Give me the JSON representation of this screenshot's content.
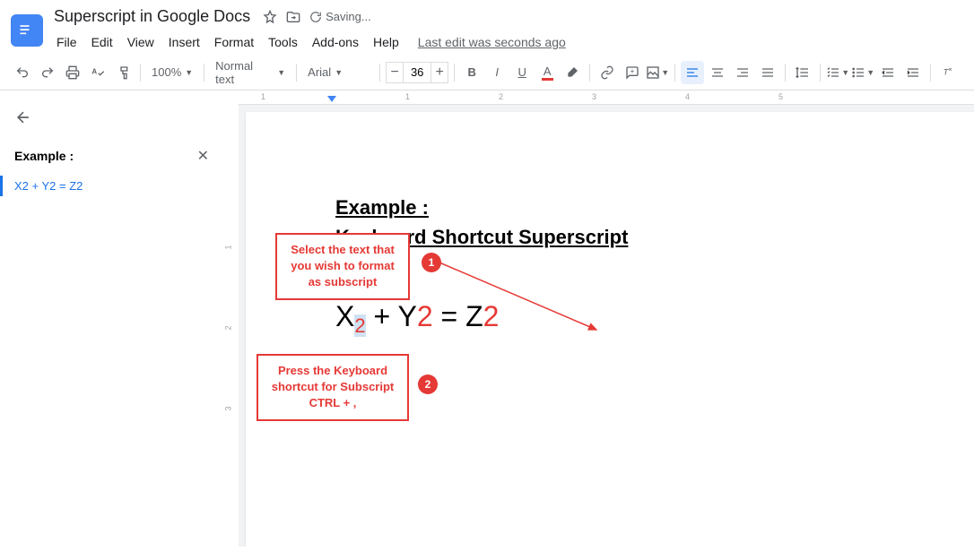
{
  "header": {
    "doc_title": "Superscript in Google Docs",
    "saving_label": "Saving...",
    "last_edit": "Last edit was seconds ago"
  },
  "menubar": [
    "File",
    "Edit",
    "View",
    "Insert",
    "Format",
    "Tools",
    "Add-ons",
    "Help"
  ],
  "toolbar": {
    "zoom": "100%",
    "style": "Normal text",
    "font": "Arial",
    "font_size": "36"
  },
  "outline": {
    "header": "Example :",
    "items": [
      "X2 + Y2 = Z2"
    ]
  },
  "hruler": {
    "ticks": [
      "1",
      "",
      "1",
      "2",
      "3",
      "4",
      "5"
    ]
  },
  "vruler": {
    "ticks": [
      "1",
      "2",
      "3"
    ]
  },
  "document": {
    "line1": "Example :",
    "line2": "Keyboard Shortcut Superscript",
    "eq": {
      "p1": "X",
      "sub": "2",
      "p2": " + Y",
      "p2_red": "2",
      "p3": " = Z",
      "p3_red": "2"
    }
  },
  "callouts": {
    "c1": {
      "line1": "Select the text that",
      "line2": "you wish to format",
      "line3": "as subscript",
      "badge": "1"
    },
    "c2": {
      "line1": "Press the Keyboard",
      "line2": "shortcut for Subscript",
      "line3": "CTRL  + ,",
      "badge": "2"
    }
  }
}
